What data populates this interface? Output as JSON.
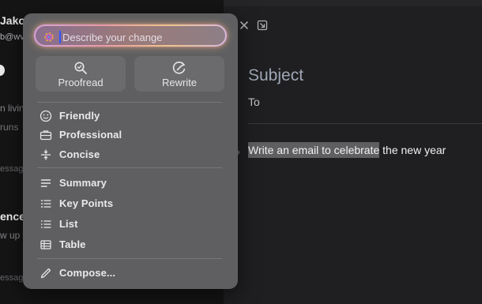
{
  "background_list": {
    "sender_name": "Jakob",
    "sender_email": "b@wv",
    "snippet_1": "n livin",
    "snippet_2": "runs",
    "message_label_1": "essag",
    "subject_2": "ence.",
    "snippet_3": "w up t",
    "message_label_2": "essag"
  },
  "compose": {
    "close_icon": "close-icon",
    "expand_icon": "expand-icon",
    "subject_placeholder": "Subject",
    "to_label": "To",
    "body_selected": "Write an email to celebrate",
    "body_rest": " the new year"
  },
  "writing_tools": {
    "prompt_placeholder": "Describe your change",
    "prompt_value": "",
    "proofread_label": "Proofread",
    "rewrite_label": "Rewrite",
    "tone_items": [
      {
        "label": "Friendly",
        "icon": "smiley-icon"
      },
      {
        "label": "Professional",
        "icon": "briefcase-icon"
      },
      {
        "label": "Concise",
        "icon": "concise-icon"
      }
    ],
    "format_items": [
      {
        "label": "Summary",
        "icon": "summary-icon"
      },
      {
        "label": "Key Points",
        "icon": "key-points-icon"
      },
      {
        "label": "List",
        "icon": "list-icon"
      },
      {
        "label": "Table",
        "icon": "table-icon"
      }
    ],
    "compose_label": "Compose...",
    "compose_icon": "pencil-icon"
  },
  "colors": {
    "popover_bg": "#5f5f61",
    "selection_bg": "#5f5f61",
    "caret": "#2e55ff"
  }
}
